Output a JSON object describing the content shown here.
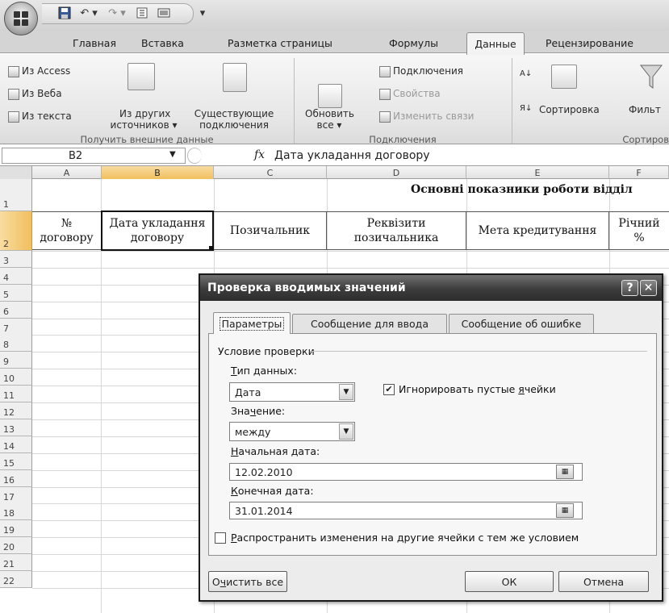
{
  "quick_access": {
    "icons": [
      "save-icon",
      "undo-icon",
      "redo-icon",
      "sort-icon",
      "view-icon",
      "customize-icon"
    ]
  },
  "tabs": [
    {
      "label": "Главная"
    },
    {
      "label": "Вставка"
    },
    {
      "label": "Разметка страницы"
    },
    {
      "label": "Формулы"
    },
    {
      "label": "Данные",
      "active": true
    },
    {
      "label": "Рецензирование"
    }
  ],
  "ribbon": {
    "get_external": {
      "from_access": "Из Access",
      "from_web": "Из Веба",
      "from_text": "Из текста",
      "other_sources_1": "Из других",
      "other_sources_2": "источников ▾",
      "existing_1": "Существующие",
      "existing_2": "подключения",
      "group_label": "Получить внешние данные"
    },
    "connections": {
      "refresh_1": "Обновить",
      "refresh_2": "все ▾",
      "connections": "Подключения",
      "properties": "Свойства",
      "edit_links": "Изменить связи",
      "group_label": "Подключения"
    },
    "sort": {
      "sort": "Сортировка",
      "filter": "Фильт",
      "group_label": "Сортиров",
      "az": "А↓",
      "za": "Я↓"
    }
  },
  "formula_bar": {
    "name_box": "B2",
    "fx": "fx",
    "content": "Дата укладання договору"
  },
  "sheet": {
    "columns": [
      "A",
      "B",
      "C",
      "D",
      "E",
      "F"
    ],
    "rows": [
      "1",
      "2",
      "3",
      "4",
      "5",
      "6",
      "7",
      "8",
      "9",
      "10",
      "11",
      "12",
      "13",
      "14",
      "15",
      "16",
      "17",
      "18",
      "19",
      "20",
      "21",
      "22"
    ],
    "title": "Основні показники роботи відділ",
    "headers": {
      "a_1": "№",
      "a_2": "договору",
      "b_1": "Дата укладання",
      "b_2": "договору",
      "c": "Позичальник",
      "d_1": "Реквізити",
      "d_2": "позичальника",
      "e": "Мета кредитування",
      "f_1": "Річний",
      "f_2": "%"
    }
  },
  "dialog": {
    "title": "Проверка вводимых значений",
    "help": "?",
    "close": "✕",
    "tabs": [
      "Параметры",
      "Сообщение для ввода",
      "Сообщение об ошибке"
    ],
    "condition_label": "Условие проверки",
    "data_type_label_u": "Т",
    "data_type_label": "ип данных:",
    "data_type_value": "Дата",
    "ignore_blank_pre": "Игнорировать пустые ",
    "ignore_blank_u": "я",
    "ignore_blank_post": "чейки",
    "ignore_blank_checked": true,
    "value_label_pre": "Зна",
    "value_label_u": "ч",
    "value_label_post": "ение:",
    "value_value": "между",
    "start_label_u": "Н",
    "start_label": "ачальная дата:",
    "start_value": "12.02.2010",
    "end_label_u": "К",
    "end_label": "онечная дата:",
    "end_value": "31.01.2014",
    "propagate_u": "Р",
    "propagate": "аспространить изменения на другие ячейки с тем же условием",
    "propagate_checked": false,
    "clear_pre": "О",
    "clear_u": "ч",
    "clear_post": "истить все",
    "ok": "ОК",
    "cancel": "Отмена"
  }
}
